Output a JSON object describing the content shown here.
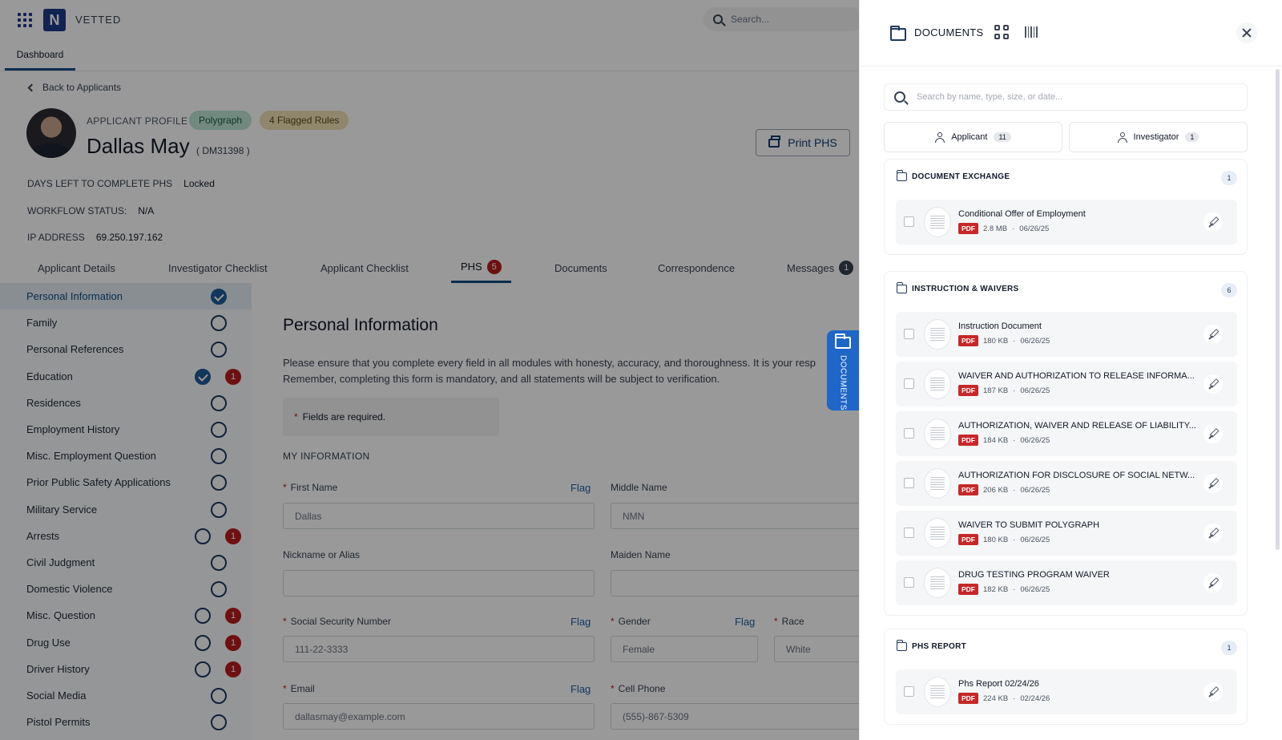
{
  "app": {
    "brand": "VETTED",
    "logo_letter": "N",
    "search_placeholder": "Search...",
    "nav_tab": "Dashboard"
  },
  "applicant": {
    "back_label": "Back to Applicants",
    "profile_label": "APPLICANT PROFILE",
    "chips": [
      "Polygraph",
      "4 Flagged Rules"
    ],
    "name": "Dallas May",
    "id": "( DM31398 )",
    "print_label": "Print PHS",
    "meta": [
      {
        "label": "DAYS LEFT TO COMPLETE PHS",
        "value": "Locked"
      },
      {
        "label": "WORKFLOW STATUS:",
        "value": "N/A"
      },
      {
        "label": "IP ADDRESS",
        "value": "69.250.197.162"
      }
    ]
  },
  "tabs": [
    {
      "label": "Applicant Details"
    },
    {
      "label": "Investigator Checklist"
    },
    {
      "label": "Applicant Checklist"
    },
    {
      "label": "PHS",
      "badge": "5"
    },
    {
      "label": "Documents"
    },
    {
      "label": "Correspondence"
    },
    {
      "label": "Messages",
      "badge": "1"
    }
  ],
  "sidebar": {
    "items": [
      {
        "label": "Personal Information",
        "status": "done",
        "alert": ""
      },
      {
        "label": "Family",
        "status": "open",
        "alert": ""
      },
      {
        "label": "Personal References",
        "status": "open",
        "alert": ""
      },
      {
        "label": "Education",
        "status": "done",
        "alert": "1"
      },
      {
        "label": "Residences",
        "status": "open",
        "alert": ""
      },
      {
        "label": "Employment History",
        "status": "open",
        "alert": ""
      },
      {
        "label": "Misc. Employment Question",
        "status": "open",
        "alert": ""
      },
      {
        "label": "Prior Public Safety Applications",
        "status": "open",
        "alert": ""
      },
      {
        "label": "Military Service",
        "status": "open",
        "alert": ""
      },
      {
        "label": "Arrests",
        "status": "open",
        "alert": "1"
      },
      {
        "label": "Civil Judgment",
        "status": "open",
        "alert": ""
      },
      {
        "label": "Domestic Violence",
        "status": "open",
        "alert": ""
      },
      {
        "label": "Misc. Question",
        "status": "open",
        "alert": "1"
      },
      {
        "label": "Drug Use",
        "status": "open",
        "alert": "1"
      },
      {
        "label": "Driver History",
        "status": "open",
        "alert": "1"
      },
      {
        "label": "Social Media",
        "status": "open",
        "alert": ""
      },
      {
        "label": "Pistol Permits",
        "status": "open",
        "alert": ""
      }
    ]
  },
  "form": {
    "title": "Personal Information",
    "intro_1": "Please ensure that you complete every field in all modules with honesty, accuracy, and thoroughness. It is your resp",
    "intro_2": "Remember, completing this form is mandatory, and all statements will be subject to verification.",
    "required_note": "Fields are required.",
    "section": "MY INFORMATION",
    "flag_label": "Flag",
    "fields": {
      "first_name": {
        "label": "First Name",
        "value": "Dallas"
      },
      "middle_name": {
        "label": "Middle Name",
        "value": "NMN"
      },
      "nickname": {
        "label": "Nickname or Alias",
        "value": ""
      },
      "maiden_name": {
        "label": "Maiden Name",
        "value": ""
      },
      "ssn": {
        "label": "Social Security Number",
        "value": "111-22-3333"
      },
      "gender": {
        "label": "Gender",
        "value": "Female"
      },
      "race": {
        "label": "Race",
        "value": "White"
      },
      "email": {
        "label": "Email",
        "value": "dallasmay@example.com"
      },
      "cell": {
        "label": "Cell Phone",
        "value": "(555)-867-5309"
      }
    }
  },
  "doc_tab_label": "DOCUMENTS",
  "drawer": {
    "title": "DOCUMENTS",
    "search_placeholder": "Search by name, type, size, or date...",
    "segments": [
      {
        "label": "Applicant",
        "count": "11"
      },
      {
        "label": "Investigator",
        "count": "1"
      }
    ],
    "file_type": "PDF",
    "groups": [
      {
        "title": "DOCUMENT EXCHANGE",
        "count": "1",
        "docs": [
          {
            "name": "Conditional Offer of Employment",
            "size": "2.8 MB",
            "date": "06/26/25"
          }
        ]
      },
      {
        "title": "INSTRUCTION & WAIVERS",
        "count": "6",
        "docs": [
          {
            "name": "Instruction Document",
            "size": "180 KB",
            "date": "06/26/25"
          },
          {
            "name": "WAIVER AND AUTHORIZATION TO RELEASE INFORMA...",
            "size": "187 KB",
            "date": "06/26/25"
          },
          {
            "name": "AUTHORIZATION, WAIVER AND RELEASE OF LIABILITY...",
            "size": "184 KB",
            "date": "06/26/25"
          },
          {
            "name": "AUTHORIZATION FOR DISCLOSURE OF SOCIAL NETW...",
            "size": "206 KB",
            "date": "06/26/25"
          },
          {
            "name": "WAIVER TO SUBMIT POLYGRAPH",
            "size": "180 KB",
            "date": "06/26/25"
          },
          {
            "name": "DRUG TESTING PROGRAM WAIVER",
            "size": "182 KB",
            "date": "06/26/25"
          }
        ]
      },
      {
        "title": "PHS REPORT",
        "count": "1",
        "docs": [
          {
            "name": "Phs Report 02/24/26",
            "size": "224 KB",
            "date": "02/24/26"
          }
        ]
      }
    ]
  }
}
